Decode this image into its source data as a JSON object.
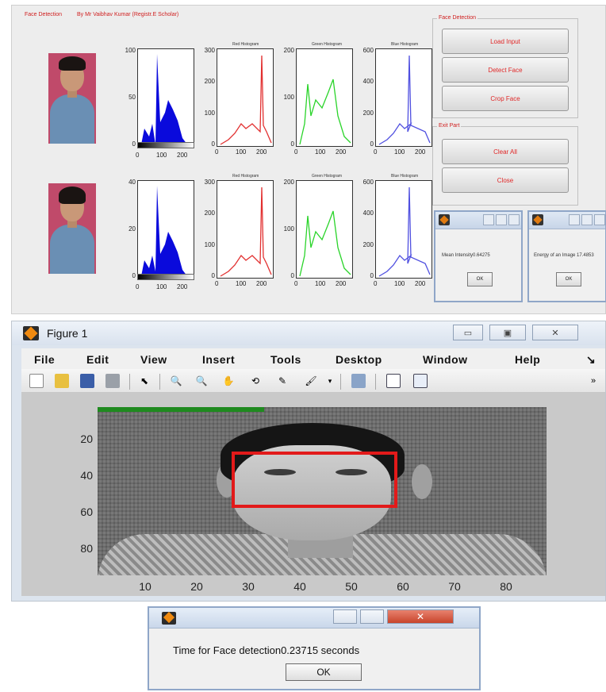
{
  "gui": {
    "panel_title": "Face Detection",
    "author_title": "By Mr Vaibhav Kumar (Registr.E Scholar)",
    "face_group_title": "Face Detection",
    "exit_group_title": "Exit Part",
    "buttons": {
      "load_input": "Load Input",
      "detect_face": "Detect Face",
      "crop_face": "Crop Face",
      "clear_all": "Clear All",
      "close": "Close"
    },
    "hist_titles": {
      "red": "Red Histogram",
      "green": "Green Histogram",
      "blue": "Blue Histogram"
    },
    "rows": [
      {
        "gray_yticks": [
          "100",
          "50",
          "0"
        ],
        "gray_xticks": [
          "0",
          "100",
          "200"
        ],
        "red_yticks": [
          "300",
          "200",
          "100",
          "0"
        ],
        "green_yticks": [
          "200",
          "100",
          "0"
        ],
        "blue_yticks": [
          "600",
          "400",
          "200",
          "0"
        ],
        "xticks": [
          "0",
          "100",
          "200"
        ]
      },
      {
        "gray_yticks": [
          "40",
          "20",
          "0"
        ],
        "gray_xticks": [
          "0",
          "100",
          "200"
        ],
        "red_yticks": [
          "300",
          "200",
          "100",
          "0"
        ],
        "green_yticks": [
          "200",
          "100",
          "0"
        ],
        "blue_yticks": [
          "600",
          "400",
          "200",
          "0"
        ],
        "xticks": [
          "0",
          "100",
          "200"
        ]
      }
    ],
    "mean_dialog": {
      "text": "Mean Intensity0.64275",
      "ok": "OK"
    },
    "energy_dialog": {
      "text": "Energy of an Image 17.4853",
      "ok": "OK"
    },
    "colors": {
      "gray": "#0a0adc",
      "red": "#e23030",
      "green": "#2ad42a",
      "blue": "#5050e0"
    }
  },
  "figure": {
    "title": "Figure 1",
    "menu": [
      "File",
      "Edit",
      "View",
      "Insert",
      "Tools",
      "Desktop",
      "Window",
      "Help"
    ],
    "menu_arrow": "↘",
    "toolbar_overflow": "»",
    "axis": {
      "yticks": [
        "20",
        "40",
        "60",
        "80"
      ],
      "xticks": [
        "10",
        "20",
        "30",
        "40",
        "50",
        "60",
        "70",
        "80"
      ]
    },
    "box_color": "#e21a1a"
  },
  "time_dialog": {
    "message": "Time for Face detection0.23715 seconds",
    "ok": "OK"
  }
}
